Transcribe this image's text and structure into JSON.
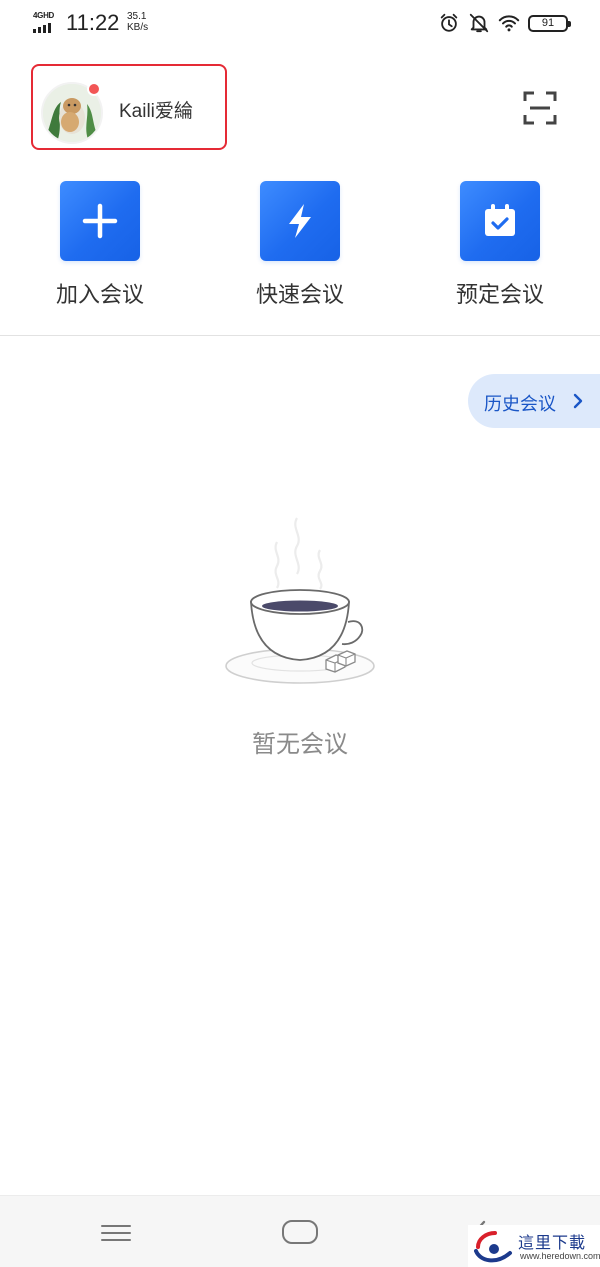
{
  "status_bar": {
    "network": "4GHD",
    "time": "11:22",
    "speed_value": "35.1",
    "speed_unit": "KB/s",
    "battery": "91",
    "icons": [
      "alarm-icon",
      "bell-muted-icon",
      "wifi-icon",
      "battery-icon"
    ]
  },
  "profile": {
    "username": "Kaili爱綸",
    "has_notification": true,
    "notification_color": "#f25656",
    "highlight_color": "#e52a35"
  },
  "header": {
    "scan_icon": "scan-icon"
  },
  "actions": [
    {
      "label": "加入会议",
      "icon": "plus-icon"
    },
    {
      "label": "快速会议",
      "icon": "lightning-icon"
    },
    {
      "label": "预定会议",
      "icon": "calendar-check-icon"
    }
  ],
  "accent_color": "#1f6cf0",
  "history": {
    "label": "历史会议",
    "icon": "chevron-right-icon"
  },
  "empty_state": {
    "illustration": "coffee-cup-icon",
    "text": "暂无会议"
  },
  "nav": {
    "icons": [
      "menu-icon",
      "home-icon",
      "back-icon"
    ]
  },
  "watermark": {
    "cn": "這里下載",
    "en": "www.heredown.com"
  }
}
